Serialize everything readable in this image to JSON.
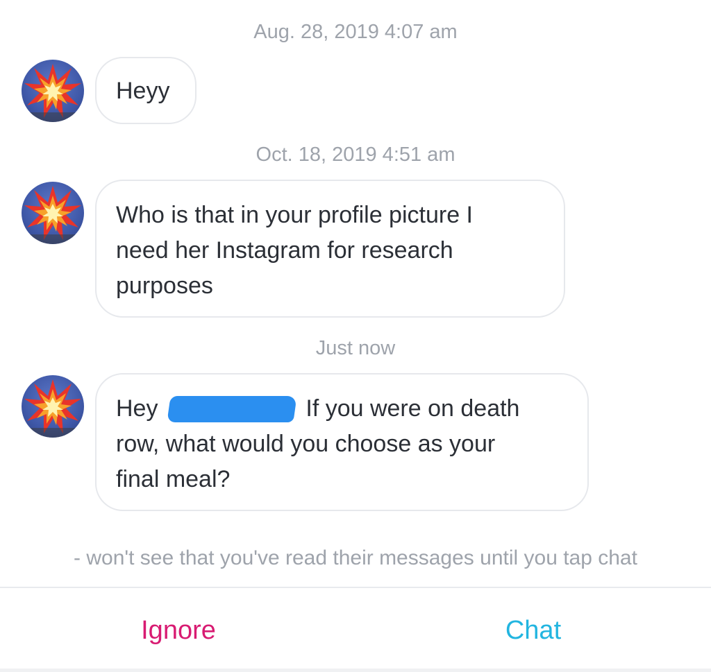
{
  "conversation": {
    "messages": [
      {
        "timestamp": "Aug. 28, 2019 4:07 am",
        "text": "Heyy"
      },
      {
        "timestamp": "Oct. 18, 2019 4:51 am",
        "text": "Who is that in your profile picture I\nneed her Instagram for research\npurposes"
      },
      {
        "timestamp": "Just now",
        "text_before": "Hey ",
        "text_after": " If you were on death\nrow, what would you choose as your\nfinal meal?"
      }
    ],
    "avatar_icon": "collision-burst-icon"
  },
  "notice": "- won't see that you've read their messages until you tap chat",
  "actions": {
    "ignore_label": "Ignore",
    "chat_label": "Chat",
    "ignore_color": "#d81b72",
    "chat_color": "#22b5e0"
  }
}
